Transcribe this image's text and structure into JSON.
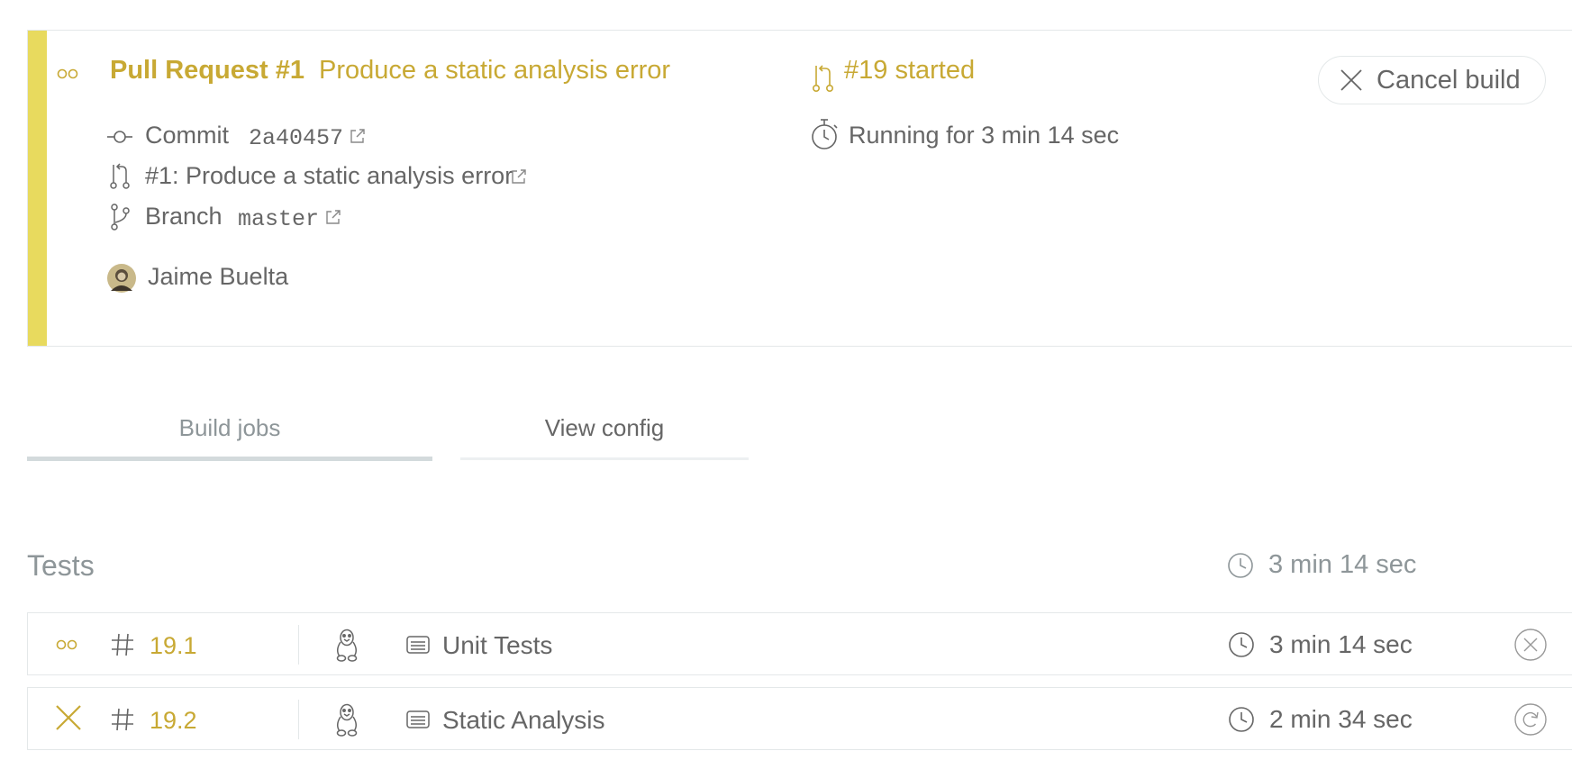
{
  "build": {
    "event_label": "Pull Request #1",
    "title": "Produce a static analysis error",
    "build_number_text": "#19 started",
    "cancel_label": "Cancel build",
    "commit_label": "Commit",
    "commit_sha": "2a40457",
    "pr_text": "#1: Produce a static analysis error",
    "branch_label": "Branch",
    "branch_name": "master",
    "running_text": "Running for 3 min 14 sec",
    "author": "Jaime Buelta"
  },
  "tabs": [
    {
      "label": "Build jobs",
      "active": true
    },
    {
      "label": "View config",
      "active": false
    }
  ],
  "stage": {
    "title": "Tests",
    "duration": "3 min 14 sec"
  },
  "jobs": [
    {
      "status": "started",
      "hash": "#",
      "number": "19.1",
      "os": "linux",
      "name": "Unit Tests",
      "duration": "3 min 14 sec",
      "action": "cancel"
    },
    {
      "status": "failed",
      "hash": "#",
      "number": "19.2",
      "os": "linux",
      "name": "Static Analysis",
      "duration": "2 min 34 sec",
      "action": "restart"
    }
  ],
  "colors": {
    "status_yellow": "#e8da5e",
    "accent_gold": "#c8a934",
    "text_grey": "#666666",
    "muted_grey": "#8e9699",
    "border": "#e4e8e9"
  },
  "icons": {
    "status_started": "dots-icon",
    "status_failed": "x-icon",
    "commit": "commit-icon",
    "pull_request": "pull-request-icon",
    "branch": "branch-icon",
    "external_link": "external-link-icon",
    "stopwatch": "stopwatch-icon",
    "clock": "clock-icon",
    "linux": "linux-tux-icon",
    "job_name": "lines-icon",
    "cancel_job": "circle-x-icon",
    "restart_job": "restart-icon"
  }
}
